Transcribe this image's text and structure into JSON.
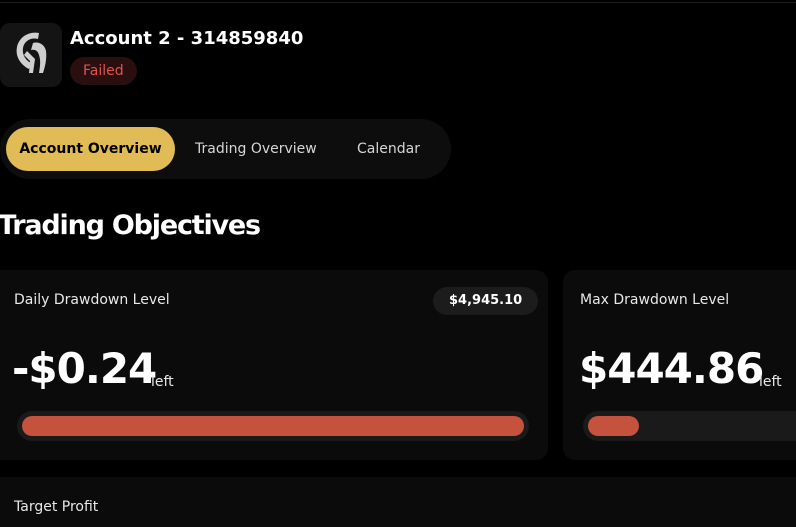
{
  "account": {
    "title": "Account 2 - 314859840",
    "status": "Failed",
    "logo_icon": "goat-logo-icon"
  },
  "tabs": [
    {
      "label": "Account Overview",
      "active": true
    },
    {
      "label": "Trading Overview",
      "active": false
    },
    {
      "label": "Calendar",
      "active": false
    }
  ],
  "section": {
    "title": "Trading Objectives"
  },
  "objectives": {
    "daily_drawdown": {
      "label": "Daily Drawdown Level",
      "amount": "$4,945.10",
      "value": "-$0.24",
      "suffix": "left",
      "progress": 1.0
    },
    "max_drawdown": {
      "label": "Max Drawdown Level",
      "value": "$444.86",
      "suffix": "left",
      "progress": 0.1
    },
    "target_profit": {
      "label": "Target Profit"
    }
  },
  "colors": {
    "accent": "#e1bb55",
    "danger": "#c4523c",
    "status_text": "#e0544e",
    "status_bg": "#2a0f10"
  }
}
